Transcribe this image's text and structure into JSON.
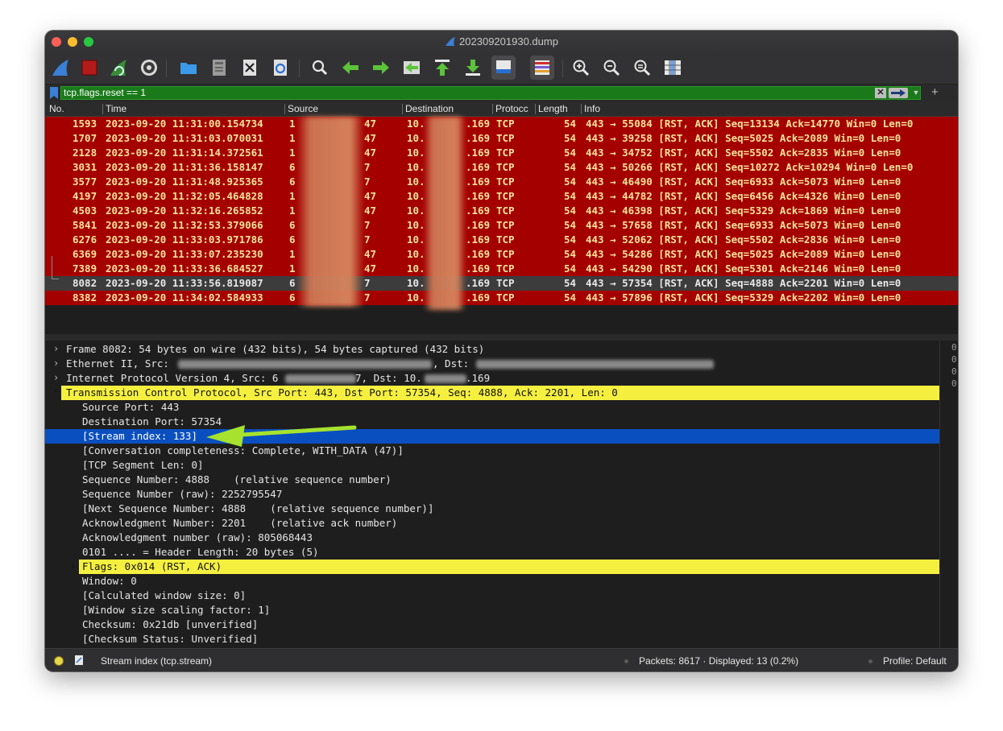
{
  "window": {
    "title": "202309201930.dump"
  },
  "toolbar": {
    "buttons": [
      "shark-fin-start-icon",
      "stop-icon",
      "restart-capture-icon",
      "capture-options-icon",
      "open-file-icon",
      "save-file-icon",
      "close-file-icon",
      "reload-icon",
      "find-packet-icon",
      "go-back-icon",
      "go-forward-icon",
      "go-to-packet-icon",
      "go-first-icon",
      "go-last-icon",
      "auto-scroll-icon",
      "colorize-icon",
      "zoom-in-icon",
      "zoom-out-icon",
      "normal-size-icon",
      "resize-columns-icon"
    ]
  },
  "filter": {
    "value": "tcp.flags.reset == 1",
    "clear_label": "✕",
    "add_label": "+"
  },
  "columns": {
    "no": "No.",
    "time": "Time",
    "source": "Source",
    "destination": "Destination",
    "protocol": "Protocc",
    "length": "Length",
    "info": "Info"
  },
  "packets": [
    {
      "no": "1593",
      "time": "2023-09-20 11:31:00.154734",
      "src": "1",
      "src_end": "47",
      "dst": "10.",
      "dst_end": ".169",
      "proto": "TCP",
      "len": "54",
      "info": "443 → 55084 [RST, ACK] Seq=13134 Ack=14770 Win=0 Len=0"
    },
    {
      "no": "1707",
      "time": "2023-09-20 11:31:03.070031",
      "src": "1",
      "src_end": "47",
      "dst": "10.",
      "dst_end": ".169",
      "proto": "TCP",
      "len": "54",
      "info": "443 → 39258 [RST, ACK] Seq=5025 Ack=2089 Win=0 Len=0"
    },
    {
      "no": "2128",
      "time": "2023-09-20 11:31:14.372561",
      "src": "1",
      "src_end": "47",
      "dst": "10.",
      "dst_end": ".169",
      "proto": "TCP",
      "len": "54",
      "info": "443 → 34752 [RST, ACK] Seq=5502 Ack=2835 Win=0 Len=0"
    },
    {
      "no": "3031",
      "time": "2023-09-20 11:31:36.158147",
      "src": "6",
      "src_end": "7",
      "dst": "10.",
      "dst_end": ".169",
      "proto": "TCP",
      "len": "54",
      "info": "443 → 50266 [RST, ACK] Seq=10272 Ack=10294 Win=0 Len=0"
    },
    {
      "no": "3577",
      "time": "2023-09-20 11:31:48.925365",
      "src": "6",
      "src_end": "7",
      "dst": "10.",
      "dst_end": ".169",
      "proto": "TCP",
      "len": "54",
      "info": "443 → 46490 [RST, ACK] Seq=6933 Ack=5073 Win=0 Len=0"
    },
    {
      "no": "4197",
      "time": "2023-09-20 11:32:05.464828",
      "src": "1",
      "src_end": "47",
      "dst": "10.",
      "dst_end": ".169",
      "proto": "TCP",
      "len": "54",
      "info": "443 → 44782 [RST, ACK] Seq=6456 Ack=4326 Win=0 Len=0"
    },
    {
      "no": "4503",
      "time": "2023-09-20 11:32:16.265852",
      "src": "1",
      "src_end": "47",
      "dst": "10.",
      "dst_end": ".169",
      "proto": "TCP",
      "len": "54",
      "info": "443 → 46398 [RST, ACK] Seq=5329 Ack=1869 Win=0 Len=0"
    },
    {
      "no": "5841",
      "time": "2023-09-20 11:32:53.379066",
      "src": "6",
      "src_end": "7",
      "dst": "10.",
      "dst_end": ".169",
      "proto": "TCP",
      "len": "54",
      "info": "443 → 57658 [RST, ACK] Seq=6933 Ack=5073 Win=0 Len=0"
    },
    {
      "no": "6276",
      "time": "2023-09-20 11:33:03.971786",
      "src": "6",
      "src_end": "7",
      "dst": "10.",
      "dst_end": ".169",
      "proto": "TCP",
      "len": "54",
      "info": "443 → 52062 [RST, ACK] Seq=5502 Ack=2836 Win=0 Len=0"
    },
    {
      "no": "6369",
      "time": "2023-09-20 11:33:07.235230",
      "src": "1",
      "src_end": "47",
      "dst": "10.",
      "dst_end": ".169",
      "proto": "TCP",
      "len": "54",
      "info": "443 → 54286 [RST, ACK] Seq=5025 Ack=2089 Win=0 Len=0"
    },
    {
      "no": "7389",
      "time": "2023-09-20 11:33:36.684527",
      "src": "1",
      "src_end": "47",
      "dst": "10.",
      "dst_end": ".169",
      "proto": "TCP",
      "len": "54",
      "info": "443 → 54290 [RST, ACK] Seq=5301 Ack=2146 Win=0 Len=0"
    },
    {
      "no": "8082",
      "time": "2023-09-20 11:33:56.819087",
      "src": "6",
      "src_end": "7",
      "dst": "10.",
      "dst_end": ".169",
      "proto": "TCP",
      "len": "54",
      "info": "443 → 57354 [RST, ACK] Seq=4888 Ack=2201 Win=0 Len=0",
      "selected": true
    },
    {
      "no": "8382",
      "time": "2023-09-20 11:34:02.584933",
      "src": "6",
      "src_end": "7",
      "dst": "10.",
      "dst_end": ".169",
      "proto": "TCP",
      "len": "54",
      "info": "443 → 57896 [RST, ACK] Seq=5329 Ack=2202 Win=0 Len=0"
    }
  ],
  "details": [
    {
      "indent": 0,
      "chev": ">",
      "text": "Frame 8082: 54 bytes on wire (432 bits), 54 bytes captured (432 bits)"
    },
    {
      "indent": 0,
      "chev": ">",
      "text": "Ethernet II, Src:",
      "text2": ", Dst:"
    },
    {
      "indent": 0,
      "chev": ">",
      "text": "Internet Protocol Version 4, Src: 6",
      "text2": "7, Dst: 10.",
      "text3": ".169"
    },
    {
      "indent": 0,
      "chev": "v",
      "text": "Transmission Control Protocol, Src Port: 443, Dst Port: 57354, Seq: 4888, Ack: 2201, Len: 0",
      "style": "yellow"
    },
    {
      "indent": 1,
      "text": "Source Port: 443"
    },
    {
      "indent": 1,
      "text": "Destination Port: 57354"
    },
    {
      "indent": 1,
      "text": "[Stream index: 133]",
      "style": "blue"
    },
    {
      "indent": 1,
      "text": "[Conversation completeness: Complete, WITH_DATA (47)]"
    },
    {
      "indent": 1,
      "text": "[TCP Segment Len: 0]"
    },
    {
      "indent": 1,
      "text": "Sequence Number: 4888    (relative sequence number)"
    },
    {
      "indent": 1,
      "text": "Sequence Number (raw): 2252795547"
    },
    {
      "indent": 1,
      "text": "[Next Sequence Number: 4888    (relative sequence number)]"
    },
    {
      "indent": 1,
      "text": "Acknowledgment Number: 2201    (relative ack number)"
    },
    {
      "indent": 1,
      "text": "Acknowledgment number (raw): 805068443"
    },
    {
      "indent": 1,
      "text": "0101 .... = Header Length: 20 bytes (5)"
    },
    {
      "indent": 1,
      "chev": ">",
      "text": "Flags: 0x014 (RST, ACK)",
      "style": "yellow"
    },
    {
      "indent": 1,
      "text": "Window: 0"
    },
    {
      "indent": 1,
      "text": "[Calculated window size: 0]"
    },
    {
      "indent": 1,
      "text": "[Window size scaling factor: 1]"
    },
    {
      "indent": 1,
      "text": "Checksum: 0x21db [unverified]"
    },
    {
      "indent": 1,
      "text": "[Checksum Status: Unverified]"
    }
  ],
  "hex": [
    "0",
    "0",
    "0",
    "0"
  ],
  "status": {
    "field": "Stream index (tcp.stream)",
    "packets": "Packets: 8617 · Displayed: 13 (0.2%)",
    "profile": "Profile: Default"
  },
  "colors": {
    "rst_row_bg": "#a40000",
    "rst_row_fg": "#f7e29a",
    "filter_ok": "#1a7a1a",
    "highlight_yellow": "#f5f040",
    "selected_blue": "#0a4fbf",
    "arrow_green": "#a6e22e"
  }
}
